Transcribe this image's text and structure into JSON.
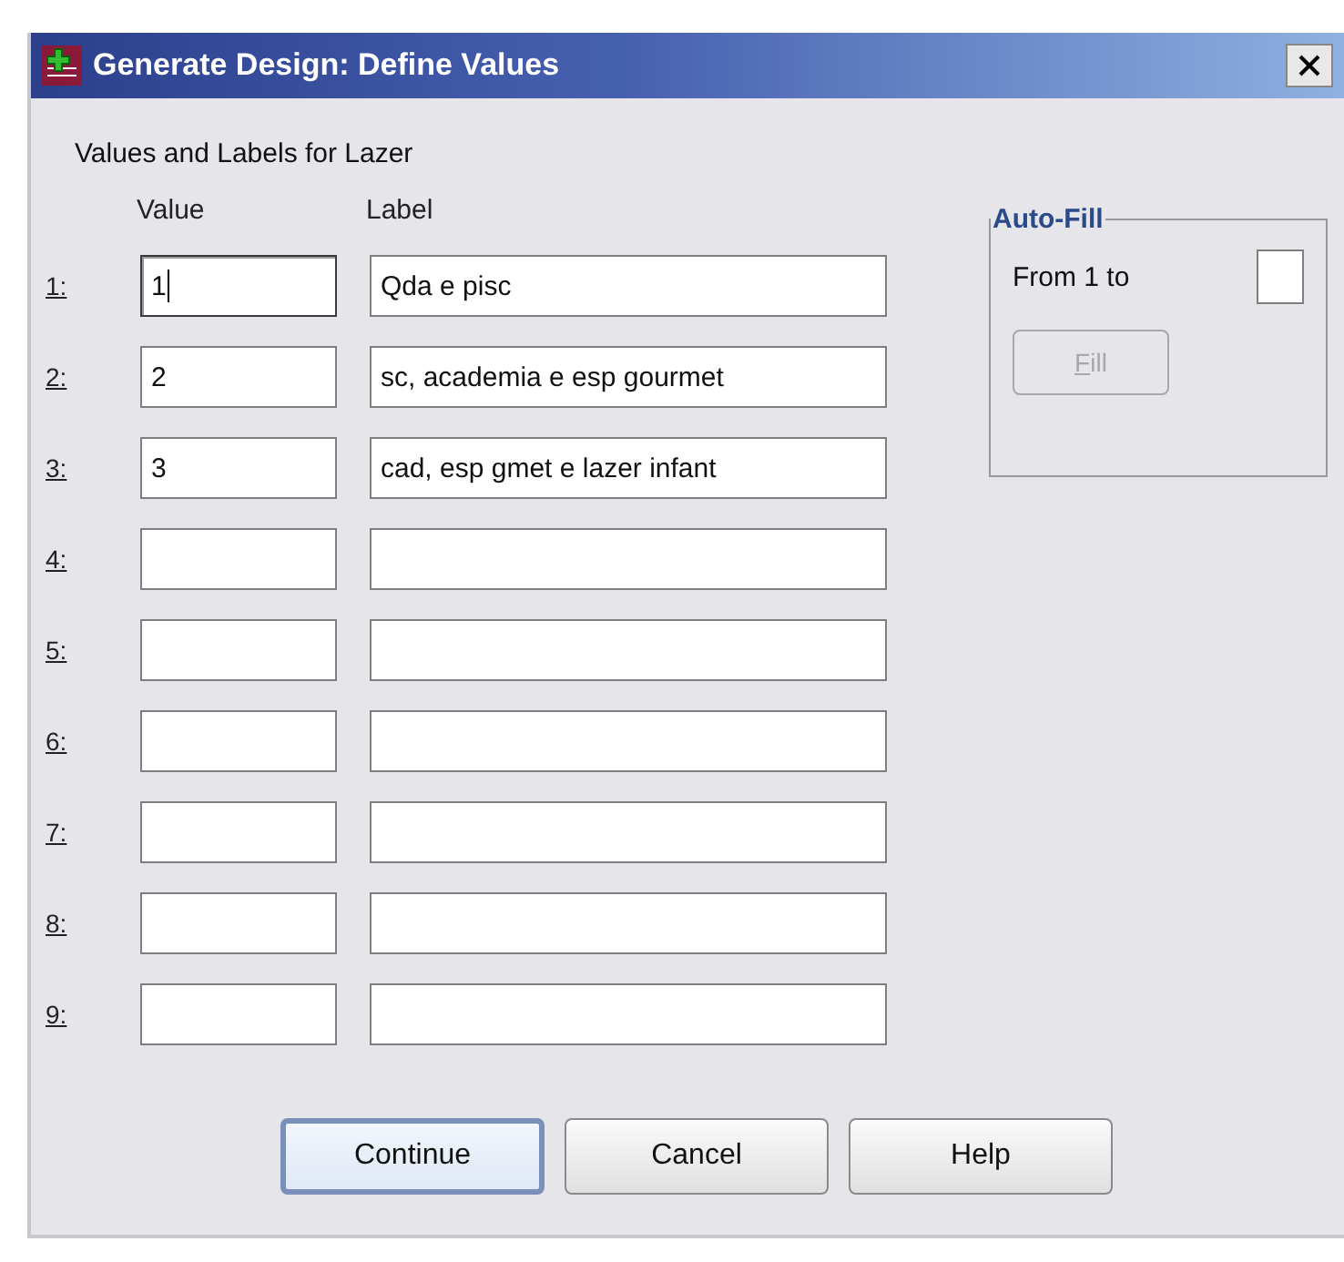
{
  "window": {
    "title": "Generate Design: Define Values"
  },
  "heading": "Values and Labels for Lazer",
  "columns": [
    "Value",
    "Label"
  ],
  "rows": [
    {
      "number": "1:",
      "value": "1",
      "label": "Qda e pisc",
      "focused": true
    },
    {
      "number": "2:",
      "value": "2",
      "label": "sc, academia e esp gourmet",
      "focused": false
    },
    {
      "number": "3:",
      "value": "3",
      "label": "cad, esp gmet e lazer infant",
      "focused": false
    },
    {
      "number": "4:",
      "focused": false
    },
    {
      "number": "5:",
      "focused": false
    },
    {
      "number": "6:",
      "focused": false
    },
    {
      "number": "7:",
      "focused": false
    },
    {
      "number": "8:",
      "focused": false
    },
    {
      "number": "9:",
      "focused": false
    }
  ],
  "auto_fill": {
    "title": "Auto-Fill",
    "from_label": "From 1 to",
    "fill_button": {
      "label": "Fill",
      "disabled": true
    }
  },
  "buttons": [
    {
      "label": "Continue",
      "selected": true
    },
    {
      "label": "Cancel",
      "selected": false
    },
    {
      "label": "Help",
      "selected": false
    }
  ]
}
